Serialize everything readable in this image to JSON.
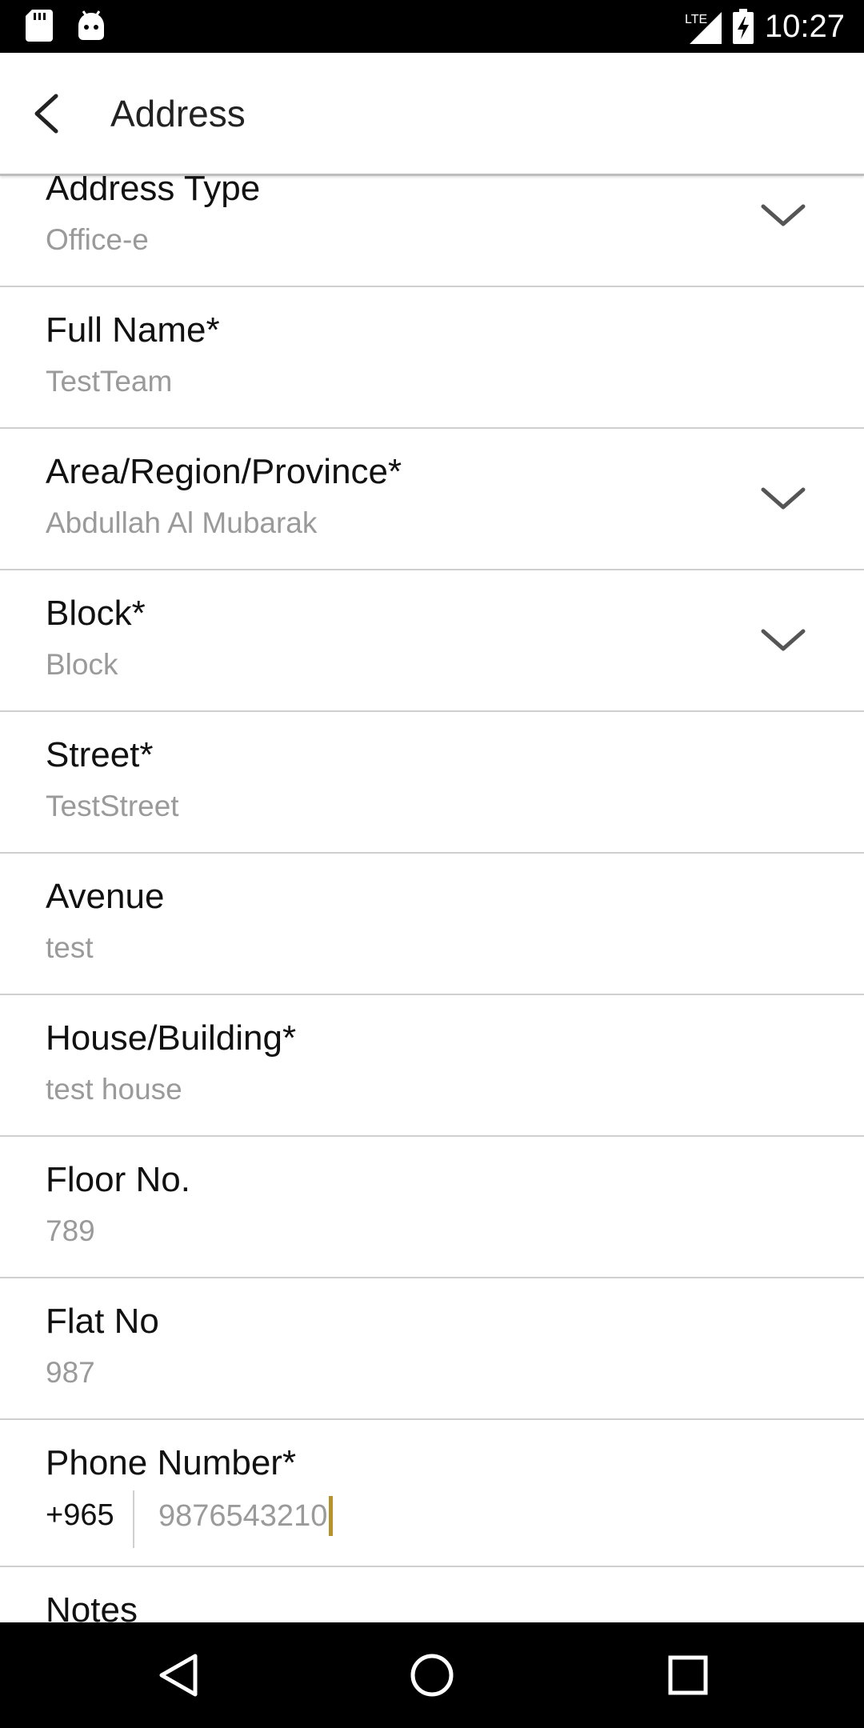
{
  "status_bar": {
    "time": "10:27",
    "network": "LTE",
    "icons": [
      "sd-card-icon",
      "android-debug-icon",
      "lte-signal-icon",
      "battery-charging-icon"
    ]
  },
  "app_bar": {
    "title": "Address",
    "back_icon": "arrow-back-icon"
  },
  "fields": [
    {
      "label": "Address Type",
      "value": "Office-e",
      "dropdown": true
    },
    {
      "label": "Full Name*",
      "value": "TestTeam",
      "dropdown": false
    },
    {
      "label": "Area/Region/Province*",
      "value": "Abdullah Al Mubarak",
      "dropdown": true
    },
    {
      "label": "Block*",
      "value": "Block",
      "dropdown": true
    },
    {
      "label": "Street*",
      "value": "TestStreet",
      "dropdown": false
    },
    {
      "label": "Avenue",
      "value": "test",
      "dropdown": false
    },
    {
      "label": "House/Building*",
      "value": "test house",
      "dropdown": false
    },
    {
      "label": "Floor No.",
      "value": "789",
      "dropdown": false
    },
    {
      "label": "Flat No",
      "value": "987",
      "dropdown": false
    }
  ],
  "phone": {
    "label": "Phone Number*",
    "country_code": "+965",
    "value": "9876543210",
    "caret_color": "#b8922a"
  },
  "notes": {
    "label": "Notes"
  },
  "nav_bar": {
    "icons": [
      "back-triangle-icon",
      "home-circle-icon",
      "recents-square-icon"
    ]
  }
}
